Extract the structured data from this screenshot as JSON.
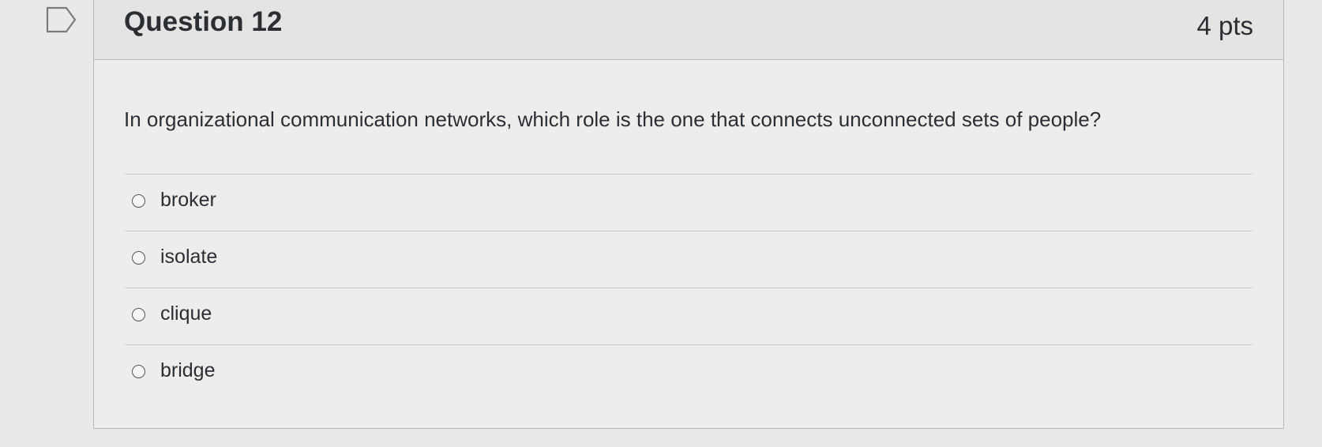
{
  "question": {
    "title": "Question 12",
    "points": "4 pts",
    "flag_icon": "flag-question-icon",
    "text": "In organizational communication networks, which role is the one that connects unconnected sets of people?",
    "options": [
      {
        "label": "broker",
        "selected": false
      },
      {
        "label": "isolate",
        "selected": false
      },
      {
        "label": "clique",
        "selected": false
      },
      {
        "label": "bridge",
        "selected": false
      }
    ]
  }
}
